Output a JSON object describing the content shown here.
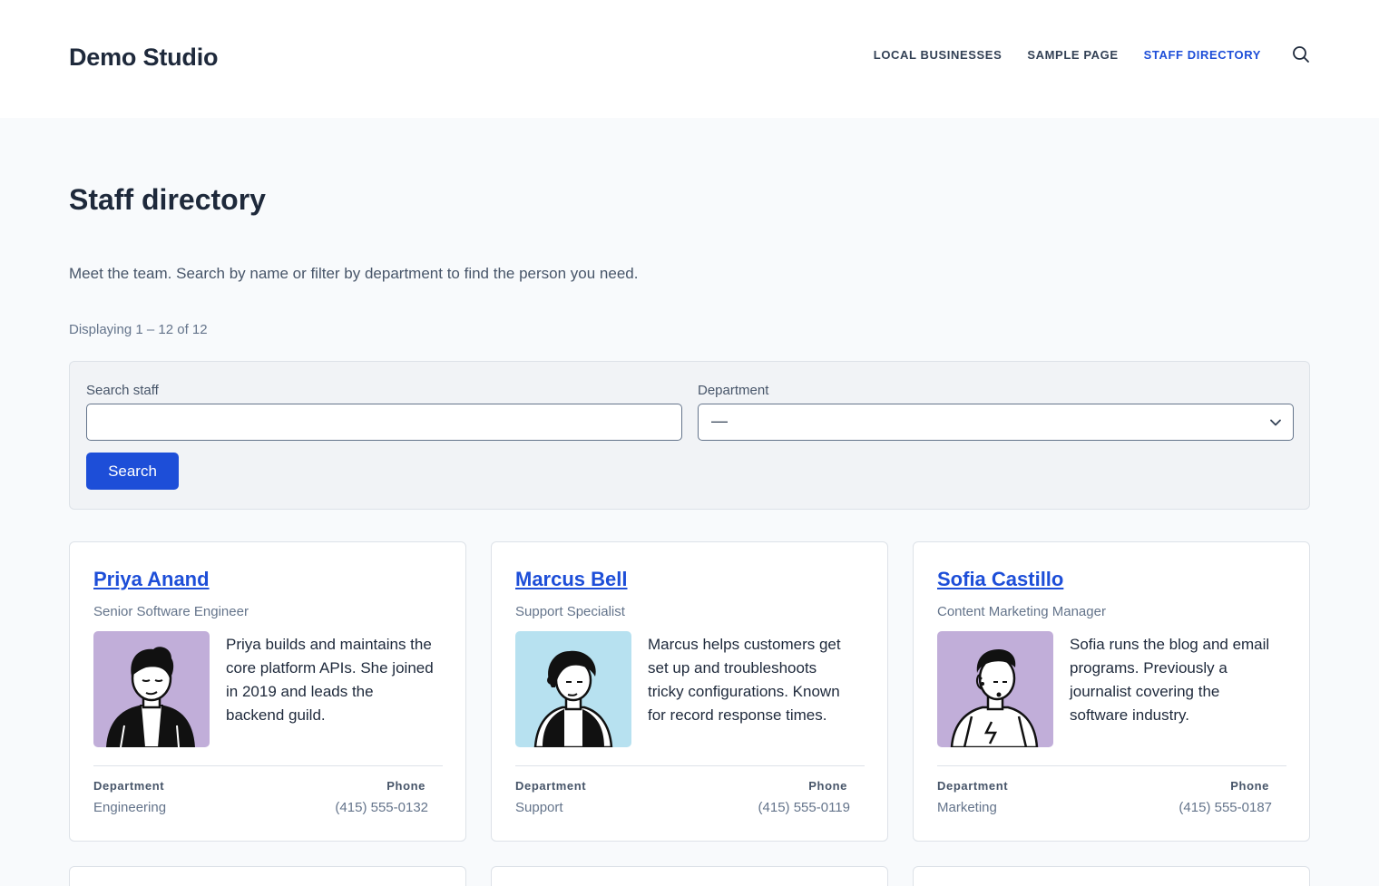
{
  "site": {
    "title": "Demo Studio"
  },
  "nav": {
    "items": [
      {
        "label": "LOCAL BUSINESSES",
        "active": false
      },
      {
        "label": "SAMPLE PAGE",
        "active": false
      },
      {
        "label": "STAFF DIRECTORY",
        "active": true
      }
    ],
    "search_icon": "search-icon"
  },
  "page": {
    "title": "Staff directory",
    "intro": "Meet the team. Search by name or filter by department to find the person you need.",
    "count": "Displaying 1 – 12 of 12"
  },
  "filter": {
    "search_label": "Search staff",
    "search_value": "",
    "department_label": "Department",
    "department_value": "—",
    "button_label": "Search"
  },
  "labels": {
    "department": "Department",
    "phone": "Phone"
  },
  "staff": [
    {
      "name": "Priya Anand",
      "role": "Senior Software Engineer",
      "bio": "Priya builds and maintains the core platform APIs. She joined in 2019 and leads the backend guild.",
      "department": "Engineering",
      "phone": "(415) 555-0132",
      "avatar_color": "#c1aed9"
    },
    {
      "name": "Marcus Bell",
      "role": "Support Specialist",
      "bio": "Marcus helps customers get set up and troubleshoots tricky configurations. Known for record response times.",
      "department": "Support",
      "phone": "(415) 555-0119",
      "avatar_color": "#b7e1f0"
    },
    {
      "name": "Sofia Castillo",
      "role": "Content Marketing Manager",
      "bio": "Sofia runs the blog and email programs. Previously a journalist covering the software industry.",
      "department": "Marketing",
      "phone": "(415) 555-0187",
      "avatar_color": "#c1aed9"
    }
  ],
  "colors": {
    "accent": "#1d4ed8",
    "page_bg": "#f8fafc",
    "panel_bg": "#f1f3f6"
  }
}
